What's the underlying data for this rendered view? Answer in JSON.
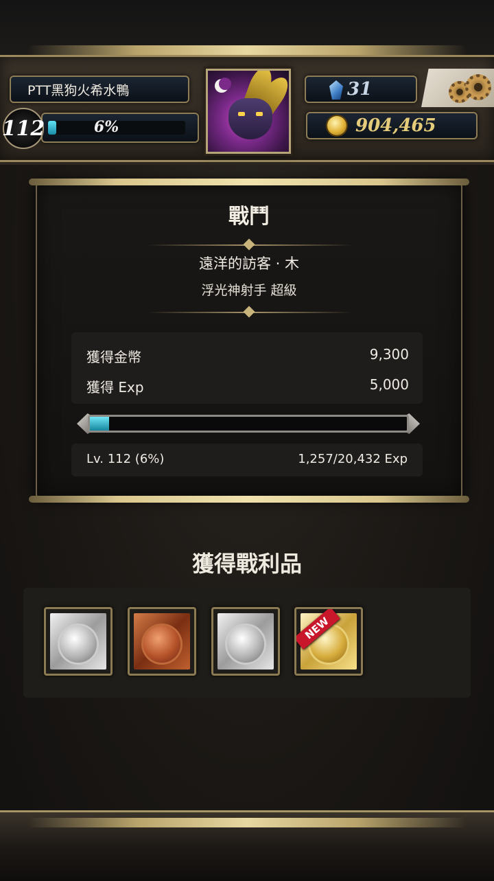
{
  "header": {
    "player_name": "PTT黑狗火希水鴨",
    "level": "112",
    "level_progress_label": "6%",
    "level_progress": 0.06,
    "gems": "31",
    "gold": "904,465"
  },
  "battle": {
    "title": "戰鬥",
    "stage_name": "遠洋的訪客 · 木",
    "stage_subtitle": "浮光神射手 超級",
    "rewards": [
      {
        "label": "獲得金幣",
        "value": "9,300"
      },
      {
        "label": "獲得 Exp",
        "value": "5,000"
      }
    ],
    "exp_progress": 0.06,
    "level_text": "Lv. 112 (6%)",
    "exp_text": "1,257/20,432 Exp"
  },
  "loot": {
    "title": "獲得戰利品",
    "items": [
      {
        "type": "silver",
        "new": false
      },
      {
        "type": "bronze",
        "new": false
      },
      {
        "type": "silver",
        "new": false
      },
      {
        "type": "gold",
        "new": true,
        "badge": "NEW"
      }
    ]
  },
  "colors": {
    "accent_gold": "#b9a46b",
    "exp_bar": "#3ac4dc",
    "panel_bg": "#1a1816"
  }
}
